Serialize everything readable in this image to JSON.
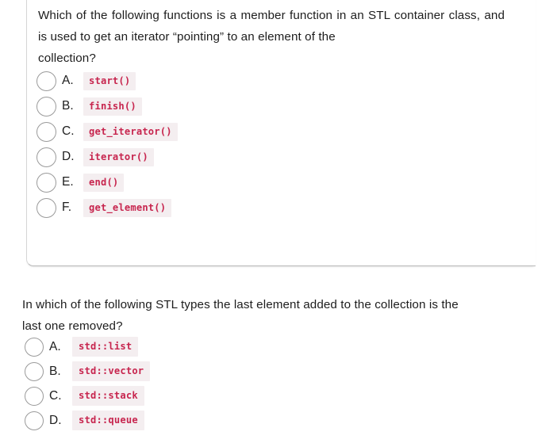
{
  "questions": [
    {
      "id": "q1",
      "text_line1": "Which of the following functions is a member function in an STL container",
      "text_line2": "class, and is used to get an iterator “pointing” to an element of the",
      "text_line3": "collection?",
      "options": [
        {
          "letter": "A.",
          "code": "start()"
        },
        {
          "letter": "B.",
          "code": "finish()"
        },
        {
          "letter": "C.",
          "code": "get_iterator()"
        },
        {
          "letter": "D.",
          "code": "iterator()"
        },
        {
          "letter": "E.",
          "code": "end()"
        },
        {
          "letter": "F.",
          "code": "get_element()"
        }
      ]
    },
    {
      "id": "q2",
      "text_line1": "In which of the following STL types the last element added to the collection",
      "text_line2": "is the last one removed?",
      "options": [
        {
          "letter": "A.",
          "code": "std::list"
        },
        {
          "letter": "B.",
          "code": "std::vector"
        },
        {
          "letter": "C.",
          "code": "std::stack"
        },
        {
          "letter": "D.",
          "code": "std::queue"
        }
      ]
    }
  ],
  "colors": {
    "code_text": "#c7254e",
    "code_background": "#f4eef0",
    "page_background": "#ffffff",
    "text": "#1d1d1d",
    "radio_border": "#9a9a9a",
    "card_border": "#d6d6d6"
  }
}
